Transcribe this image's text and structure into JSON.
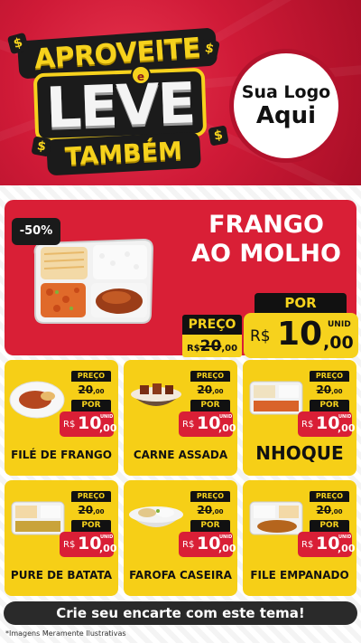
{
  "header": {
    "title_line1": "APROVEITE",
    "title_connector": "e",
    "title_line2": "LEVE",
    "title_line3": "TAMBÉM",
    "coin_symbol": "$",
    "logo_line1": "Sua Logo",
    "logo_line2": "Aqui"
  },
  "featured": {
    "badge": "-50%",
    "name_line1": "FRANGO",
    "name_line2": "AO MOLHO",
    "preco_label": "PREÇO",
    "old_currency": "R$",
    "old_int": "20",
    "old_dec": ",00",
    "por_label": "POR",
    "new_currency": "R$",
    "new_int": "10",
    "new_dec": ",00",
    "unit": "UNID"
  },
  "products": [
    {
      "name": "FILÉ DE FRANGO",
      "preco_label": "PREÇO",
      "old_int": "20",
      "old_dec": ",00",
      "por_label": "POR",
      "currency": "R$",
      "new_int": "10",
      "new_dec": ",00",
      "unit": "UNID"
    },
    {
      "name": "CARNE ASSADA",
      "preco_label": "PREÇO",
      "old_int": "20",
      "old_dec": ",00",
      "por_label": "POR",
      "currency": "R$",
      "new_int": "10",
      "new_dec": ",00",
      "unit": "UNID"
    },
    {
      "name": "NHOQUE",
      "preco_label": "PREÇO",
      "old_int": "20",
      "old_dec": ",00",
      "por_label": "POR",
      "currency": "R$",
      "new_int": "10",
      "new_dec": ",00",
      "unit": "UNID"
    },
    {
      "name": "PURE DE BATATA",
      "preco_label": "PREÇO",
      "old_int": "20",
      "old_dec": ",00",
      "por_label": "POR",
      "currency": "R$",
      "new_int": "10",
      "new_dec": ",00",
      "unit": "UNID"
    },
    {
      "name": "FAROFA CASEIRA",
      "preco_label": "PREÇO",
      "old_int": "20",
      "old_dec": ",00",
      "por_label": "POR",
      "currency": "R$",
      "new_int": "10",
      "new_dec": ",00",
      "unit": "UNID"
    },
    {
      "name": "FILE EMPANADO",
      "preco_label": "PREÇO",
      "old_int": "20",
      "old_dec": ",00",
      "por_label": "POR",
      "currency": "R$",
      "new_int": "10",
      "new_dec": ",00",
      "unit": "UNID"
    }
  ],
  "cta": "Crie seu encarte com este tema!",
  "disclaimer": "*Imagens Meramente Ilustrativas",
  "colors": {
    "brand_red": "#d91f36",
    "brand_yellow": "#f6cf17",
    "dark": "#111111"
  },
  "icons": [
    "dollar-coin-icon",
    "food-tray-icon",
    "food-bowl-icon"
  ]
}
